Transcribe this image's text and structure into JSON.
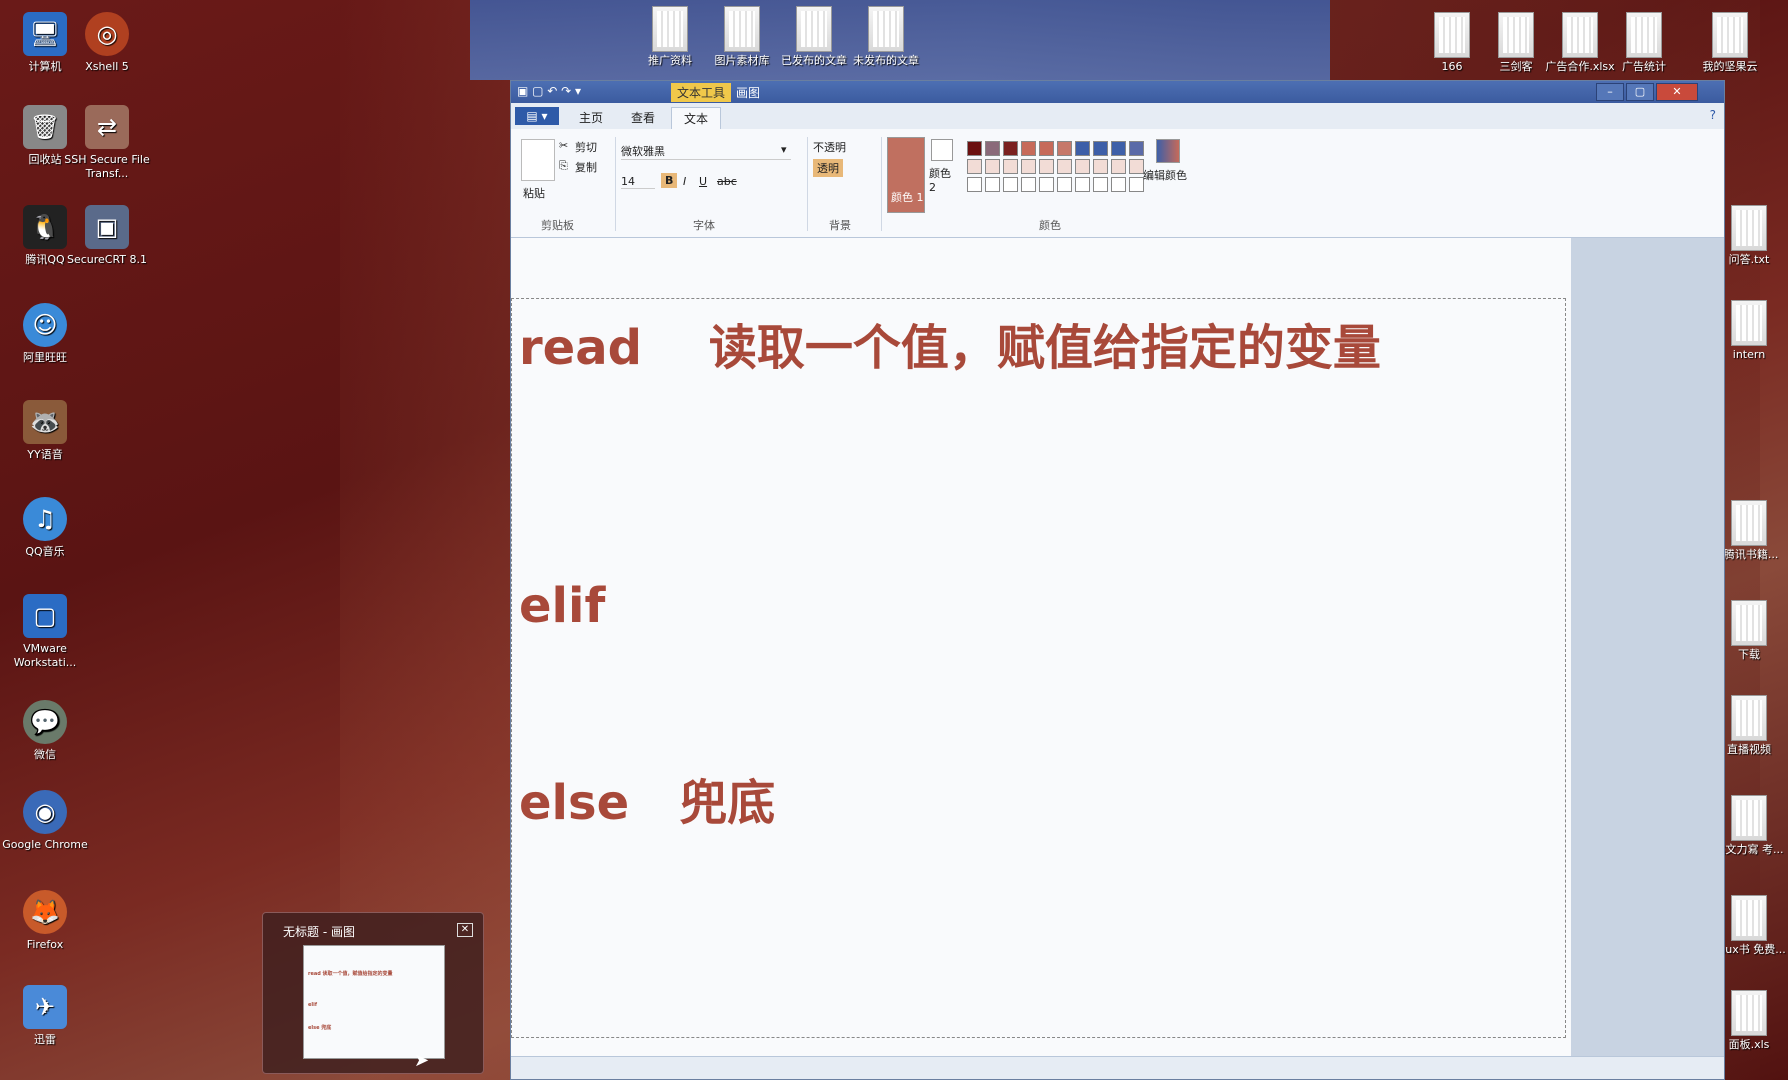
{
  "desktop": {
    "left_icons": [
      {
        "label": "计算机",
        "icon": "computer-icon"
      },
      {
        "label": "Xshell 5",
        "icon": "xshell-icon"
      },
      {
        "label": "回收站",
        "icon": "recycle-bin-icon"
      },
      {
        "label": "SSH Secure File Transf...",
        "icon": "ssh-icon"
      },
      {
        "label": "腾讯QQ",
        "icon": "qq-icon"
      },
      {
        "label": "SecureCRT 8.1",
        "icon": "securecrt-icon"
      },
      {
        "label": "阿里旺旺",
        "icon": "wangwang-icon"
      },
      {
        "label": "YY语音",
        "icon": "yy-icon"
      },
      {
        "label": "QQ音乐",
        "icon": "qqmusic-icon"
      },
      {
        "label": "VMware Workstati...",
        "icon": "vmware-icon"
      },
      {
        "label": "微信",
        "icon": "wechat-icon"
      },
      {
        "label": "Google Chrome",
        "icon": "chrome-icon"
      },
      {
        "label": "Firefox",
        "icon": "firefox-icon"
      },
      {
        "label": "迅雷",
        "icon": "xunlei-icon"
      }
    ],
    "top_icons": [
      "推广资料",
      "图片素材库",
      "已发布的文章",
      "未发布的文章"
    ],
    "right_top_icons": [
      "166",
      "三剑客",
      "广告合作.xlsx",
      "广告统计",
      "我的坚果云"
    ],
    "right_side_icons": [
      "问答.txt",
      "intern",
      "(腾讯书籍...",
      "下载",
      "直播视频",
      "达文力寫 考...",
      "linux书 免费...",
      "面板.xls"
    ]
  },
  "paint": {
    "qat": "▣ ▢ ↶ ↷ ▾",
    "context_tab": "文本工具",
    "context_group": "画图",
    "file_button": "▤ ▾",
    "tabs": [
      "主页",
      "查看",
      "文本"
    ],
    "active_tab": "文本",
    "help": "?",
    "ribbon": {
      "clipboard": {
        "paste": "粘贴",
        "cut": "剪切",
        "copy": "复制",
        "label": "剪贴板"
      },
      "font": {
        "family": "微软雅黑",
        "size": "14",
        "bold": "B",
        "italic": "I",
        "underline": "U",
        "strike": "abc",
        "label": "字体"
      },
      "background": {
        "opaque": "不透明",
        "transparent": "透明",
        "label": "背景"
      },
      "colors": {
        "color1": "颜色 1",
        "color2": "颜色 2",
        "edit": "编辑颜色",
        "label": "颜色"
      }
    },
    "canvas_lines": [
      "read    读取一个值，赋值给指定的变量",
      "elif",
      "else   兜底"
    ],
    "swatch_colors": [
      "#6b1010",
      "#8a6a7a",
      "#7a2020",
      "#c66a5a",
      "#c66a5a",
      "#c6786a",
      "#3d5fa8",
      "#3d5fa8",
      "#3d5fa8",
      "#5a6aa8"
    ]
  },
  "preview": {
    "title": "无标题 - 画图",
    "close": "✕",
    "lines": [
      "read    读取一个值，赋值给指定的变量",
      "elif",
      "else  兜底"
    ]
  }
}
